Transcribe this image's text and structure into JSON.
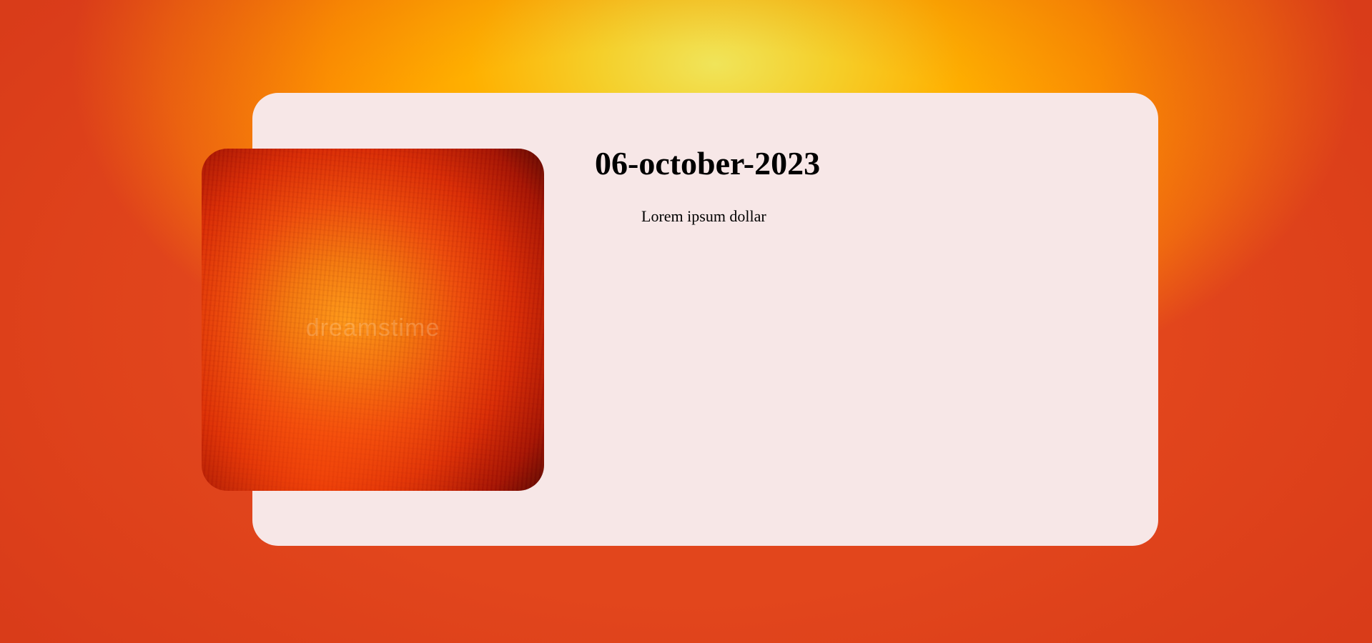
{
  "card": {
    "date_title": "06-october-2023",
    "subtitle": "Lorem ipsum dollar"
  },
  "image": {
    "watermark": "dreamstime"
  },
  "colors": {
    "card_background": "#f7e7e7",
    "page_background_center": "#f0e45a",
    "page_background_edge": "#e2461c"
  }
}
